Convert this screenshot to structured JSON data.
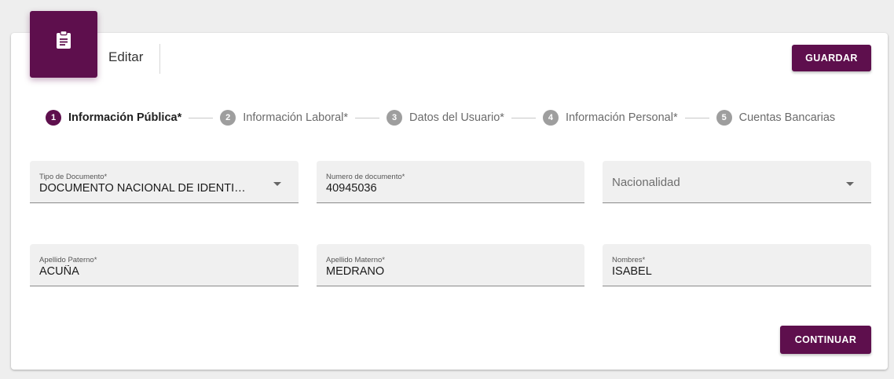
{
  "header": {
    "title": "Editar",
    "icon": "clipboard-icon",
    "save_label": "GUARDAR"
  },
  "stepper": {
    "steps": [
      {
        "number": "1",
        "label": "Información Pública*",
        "active": true
      },
      {
        "number": "2",
        "label": "Información Laboral*",
        "active": false
      },
      {
        "number": "3",
        "label": "Datos del Usuario*",
        "active": false
      },
      {
        "number": "4",
        "label": "Información Personal*",
        "active": false
      },
      {
        "number": "5",
        "label": "Cuentas Bancarias",
        "active": false
      }
    ]
  },
  "form": {
    "tipo_documento": {
      "label": "Tipo de Documento*",
      "value": "DOCUMENTO NACIONAL DE IDENTI…"
    },
    "numero_documento": {
      "label": "Numero de documento*",
      "value": "40945036"
    },
    "nacionalidad": {
      "placeholder": "Nacionalidad",
      "value": ""
    },
    "apellido_paterno": {
      "label": "Apellido Paterno*",
      "value": "ACUÑA"
    },
    "apellido_materno": {
      "label": "Apellido Materno*",
      "value": "MEDRANO"
    },
    "nombres": {
      "label": "Nombres*",
      "value": "ISABEL"
    }
  },
  "footer": {
    "continue_label": "CONTINUAR"
  },
  "colors": {
    "primary": "#5e0f4d",
    "step_inactive": "#9e9e9e",
    "field_background": "#f0f0f0",
    "page_background": "#eeeeee"
  }
}
